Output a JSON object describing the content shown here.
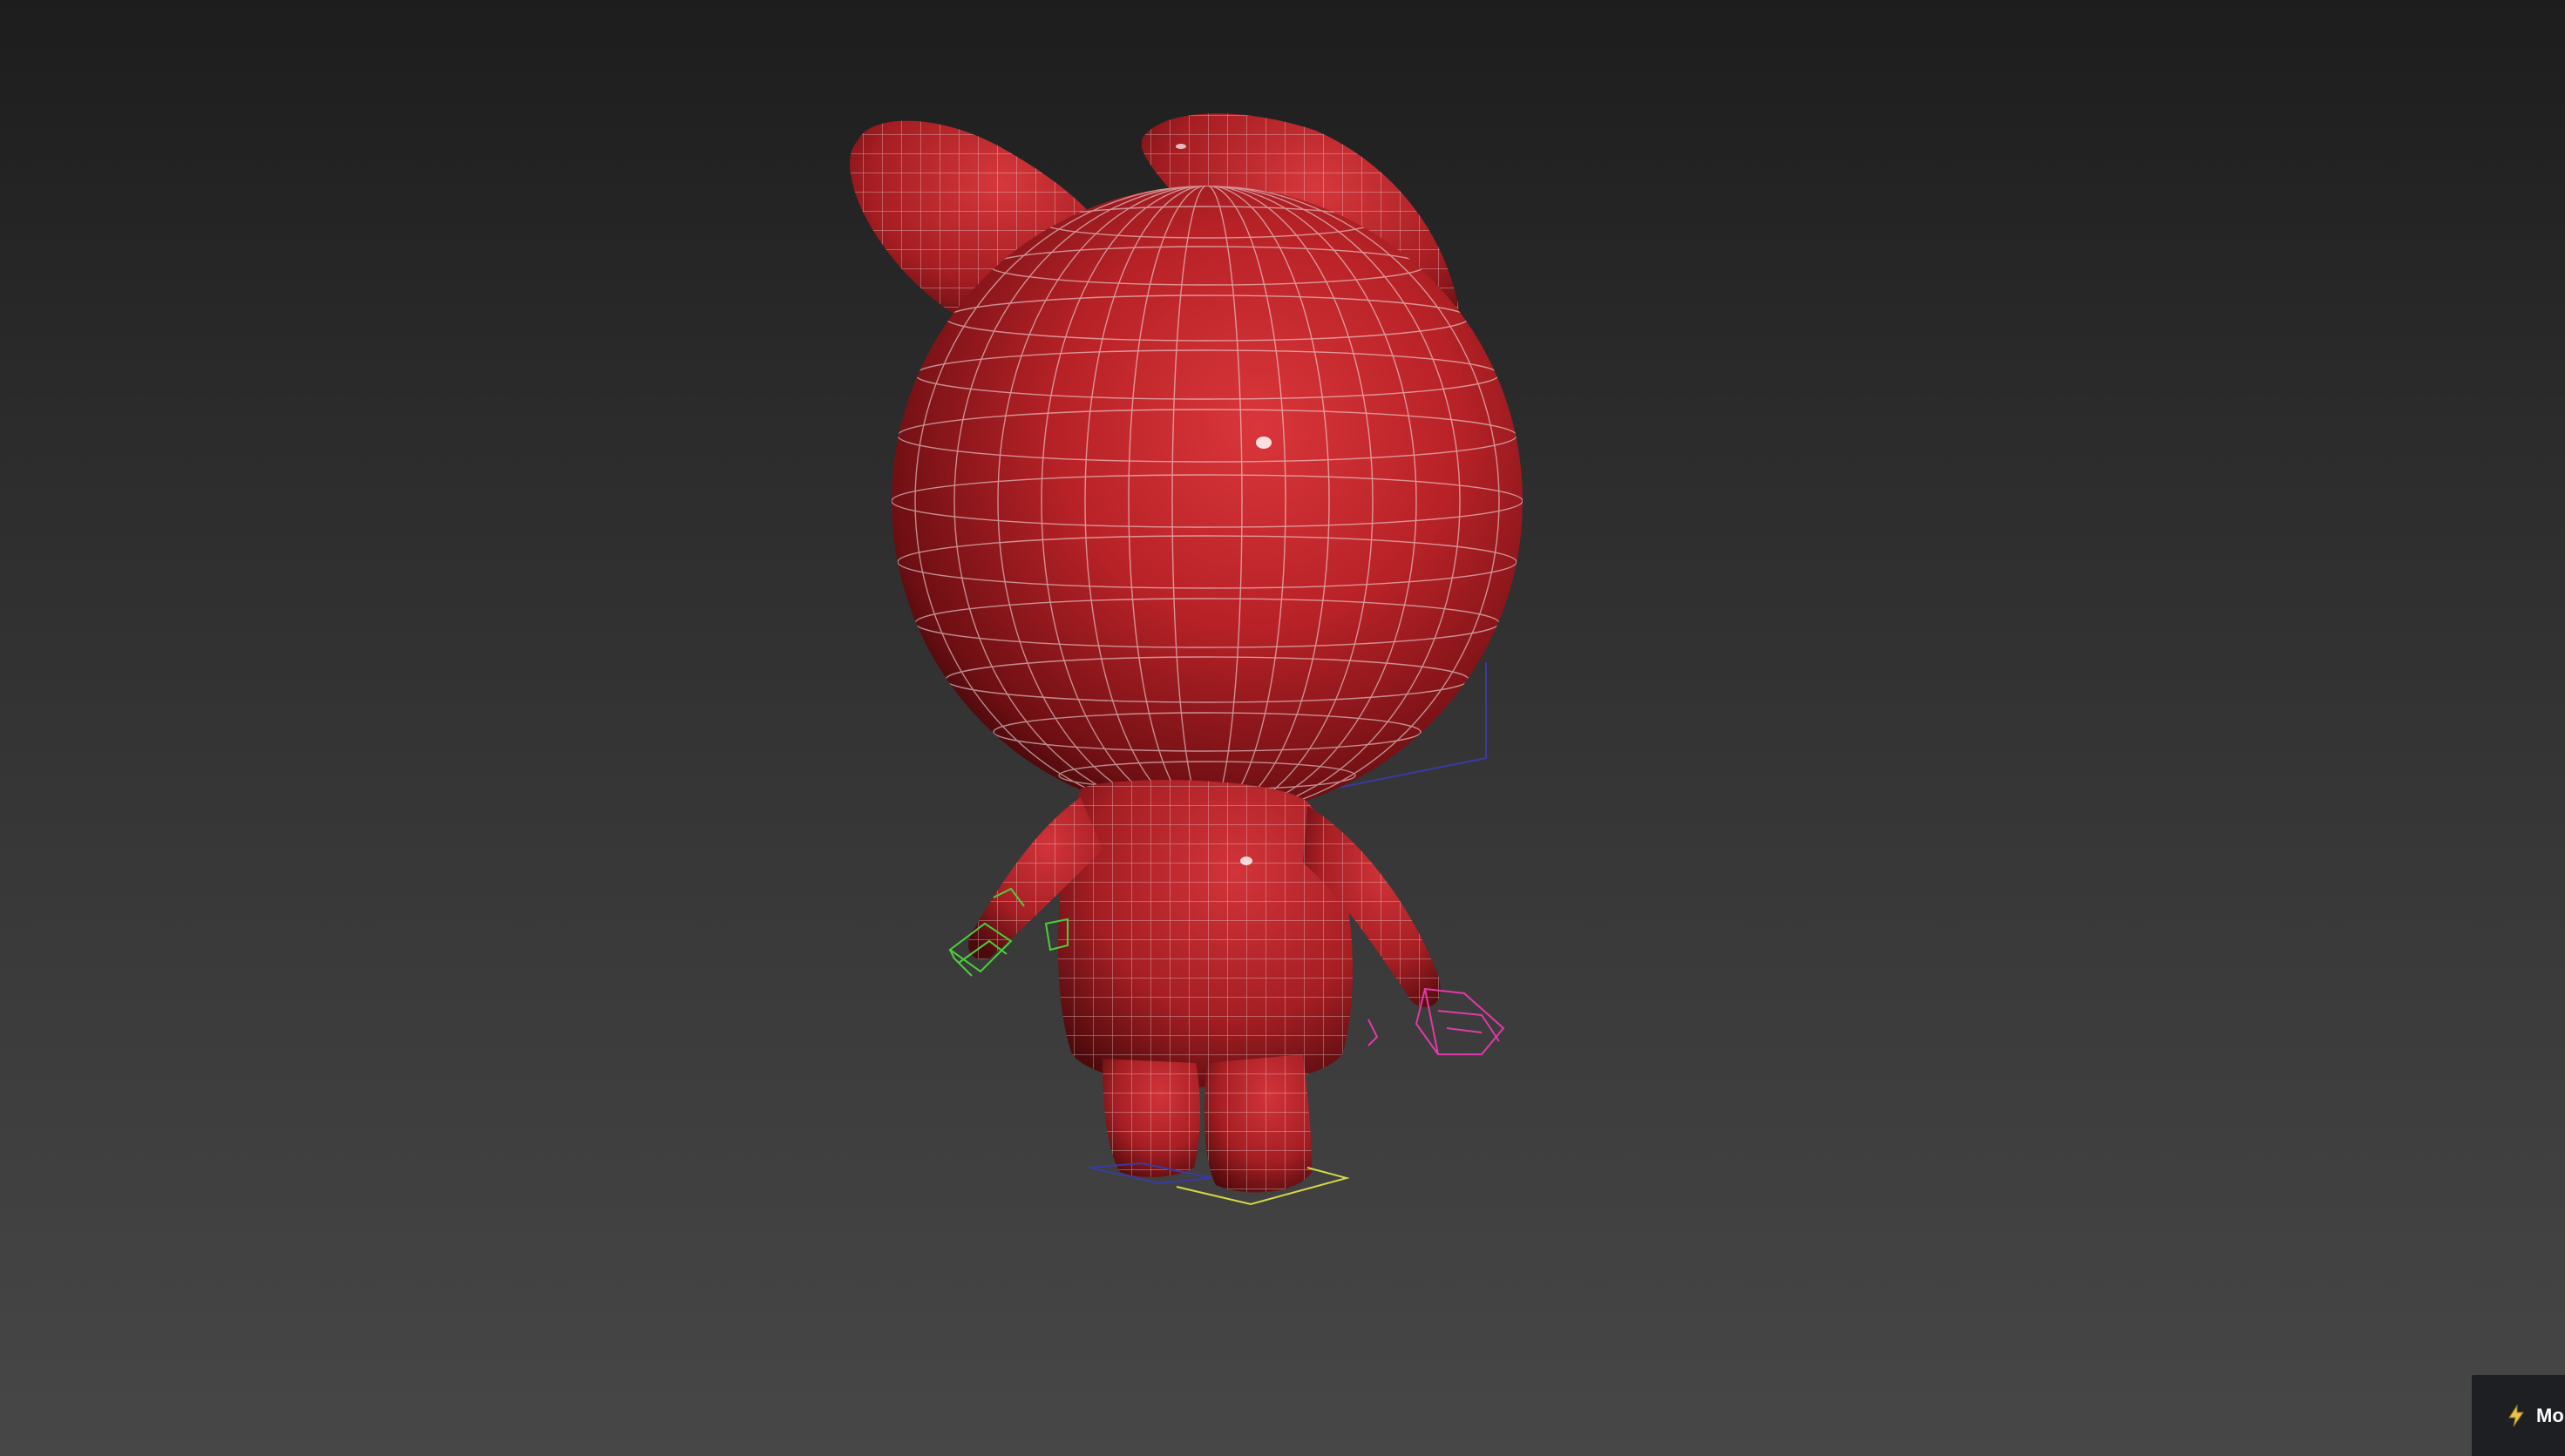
{
  "viewport": {
    "background_top": "#1d1d1d",
    "background_bottom": "#474747"
  },
  "model": {
    "body_color": "#c0272d",
    "wire_color": "#e6d6d6",
    "left_hand_helper_color": "#4ccf3c",
    "right_hand_helper_color": "#e03aa8",
    "bounding_box_color": "#3a3aa0",
    "foot_helper_color": "#d6d64a"
  },
  "status_chip": {
    "icon": "lightning-icon",
    "label": "Mo"
  }
}
